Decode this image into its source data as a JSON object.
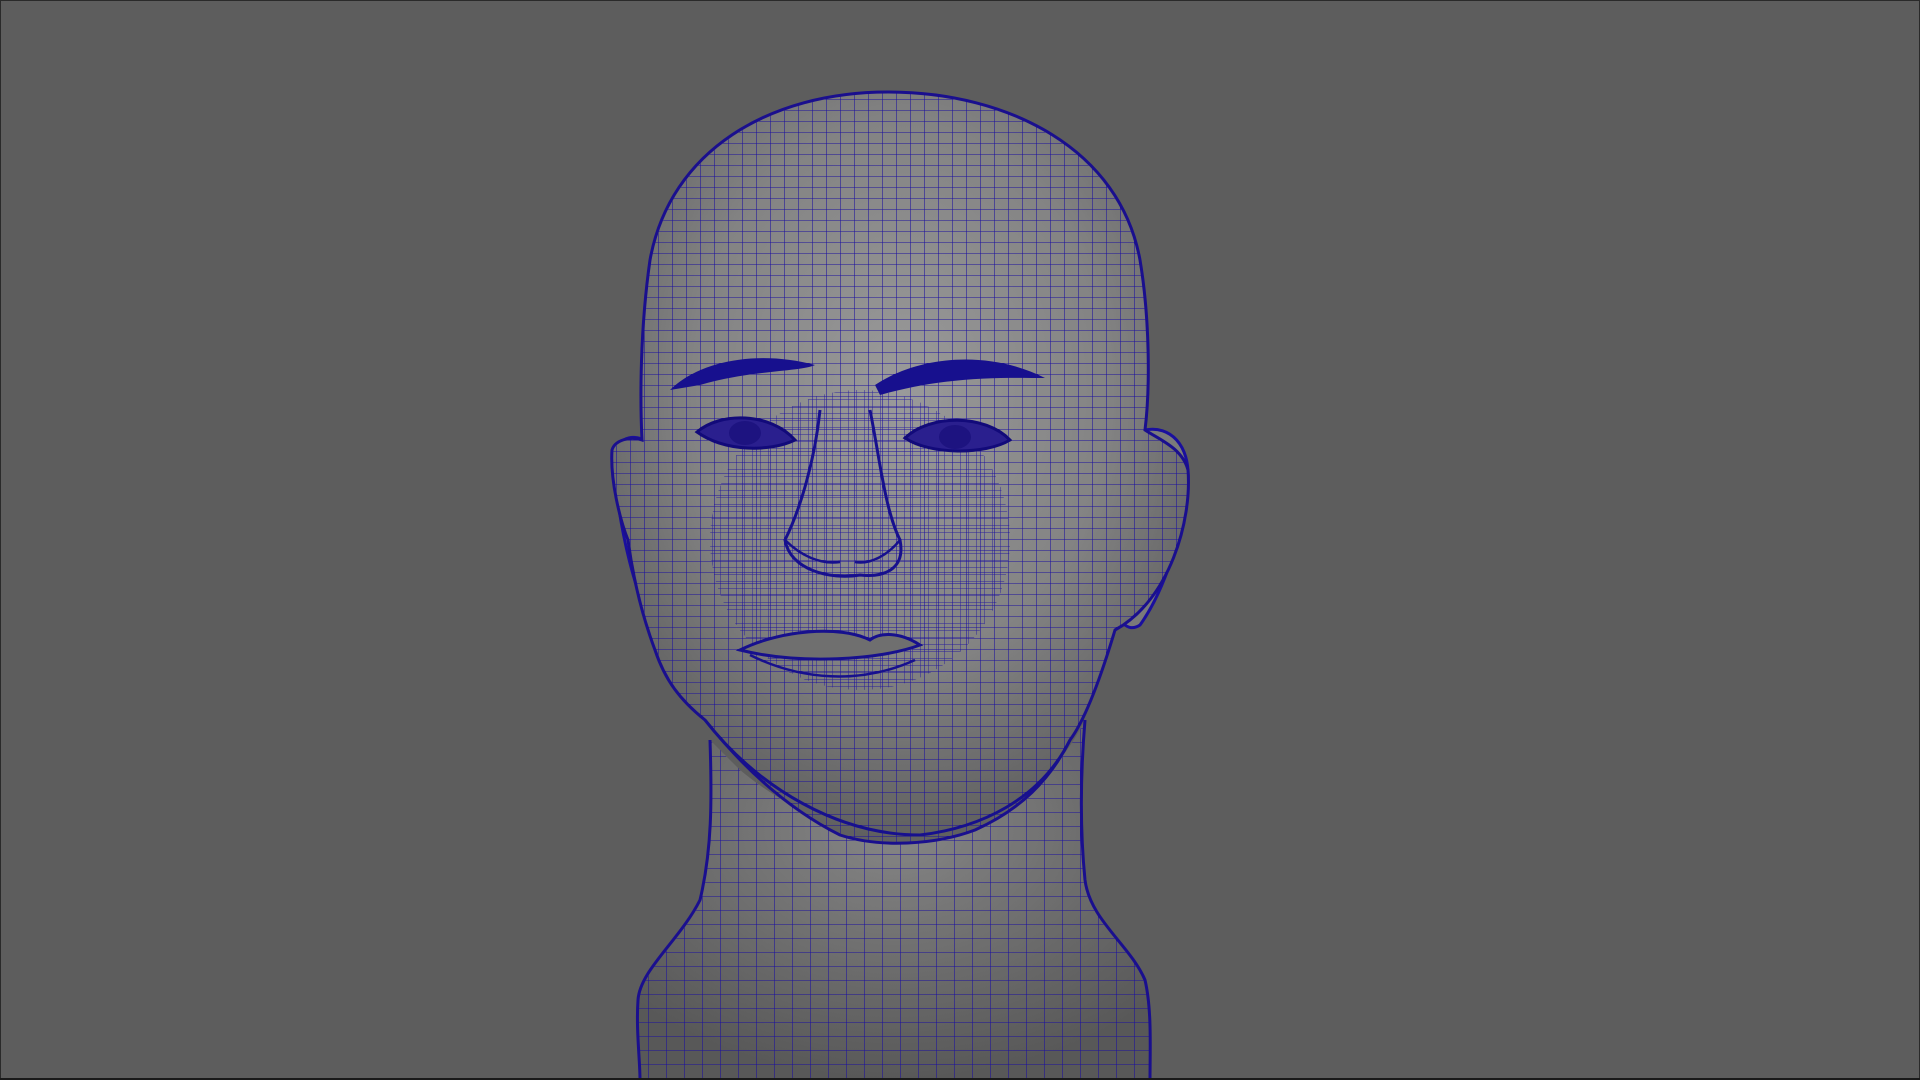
{
  "viewport": {
    "background_color": "#5d5d5d",
    "mode": "wireframe-on-shaded",
    "wireframe_color": "#1a0f9e",
    "shaded_color": "#8a8a8a"
  },
  "object": {
    "type": "head-mesh"
  }
}
